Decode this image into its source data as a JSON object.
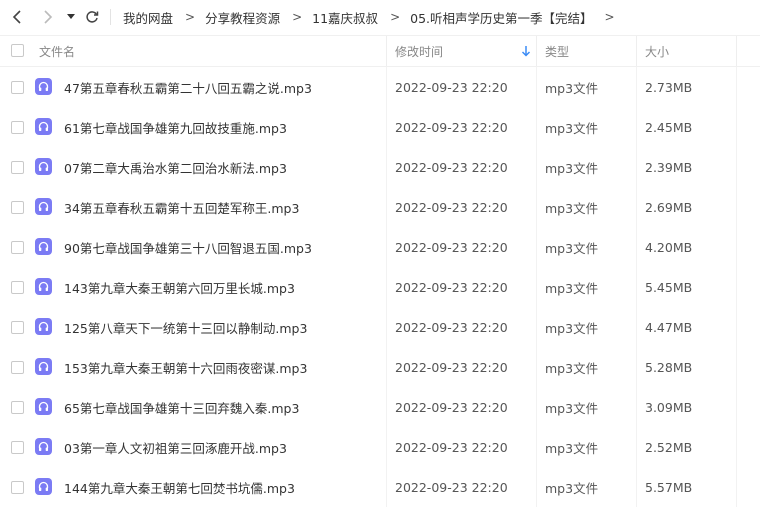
{
  "nav": {
    "back_icon": "chevron-left-icon",
    "forward_icon": "chevron-right-icon",
    "history_icon": "caret-down-icon",
    "refresh_icon": "refresh-icon"
  },
  "breadcrumb": [
    {
      "label": "我的网盘"
    },
    {
      "label": "分享教程资源"
    },
    {
      "label": "11嘉庆叔叔"
    },
    {
      "label": "05.听相声学历史第一季【完结】"
    }
  ],
  "breadcrumb_sep": ">",
  "header": {
    "name": "文件名",
    "time": "修改时间",
    "type": "类型",
    "size": "大小",
    "sort_icon": "arrow-down-icon"
  },
  "colors": {
    "file_icon_bg": "#7b7bf4",
    "sort_arrow": "#3b8cf5"
  },
  "files": [
    {
      "name": "47第五章春秋五霸第二十八回五霸之说.mp3",
      "time": "2022-09-23 22:20",
      "type": "mp3文件",
      "size": "2.73MB"
    },
    {
      "name": "61第七章战国争雄第九回故技重施.mp3",
      "time": "2022-09-23 22:20",
      "type": "mp3文件",
      "size": "2.45MB"
    },
    {
      "name": "07第二章大禹治水第二回治水新法.mp3",
      "time": "2022-09-23 22:20",
      "type": "mp3文件",
      "size": "2.39MB"
    },
    {
      "name": "34第五章春秋五霸第十五回楚军称王.mp3",
      "time": "2022-09-23 22:20",
      "type": "mp3文件",
      "size": "2.69MB"
    },
    {
      "name": "90第七章战国争雄第三十八回智退五国.mp3",
      "time": "2022-09-23 22:20",
      "type": "mp3文件",
      "size": "4.20MB"
    },
    {
      "name": "143第九章大秦王朝第六回万里长城.mp3",
      "time": "2022-09-23 22:20",
      "type": "mp3文件",
      "size": "5.45MB"
    },
    {
      "name": "125第八章天下一统第十三回以静制动.mp3",
      "time": "2022-09-23 22:20",
      "type": "mp3文件",
      "size": "4.47MB"
    },
    {
      "name": "153第九章大秦王朝第十六回雨夜密谋.mp3",
      "time": "2022-09-23 22:20",
      "type": "mp3文件",
      "size": "5.28MB"
    },
    {
      "name": "65第七章战国争雄第十三回弃魏入秦.mp3",
      "time": "2022-09-23 22:20",
      "type": "mp3文件",
      "size": "3.09MB"
    },
    {
      "name": "03第一章人文初祖第三回涿鹿开战.mp3",
      "time": "2022-09-23 22:20",
      "type": "mp3文件",
      "size": "2.52MB"
    },
    {
      "name": "144第九章大秦王朝第七回焚书坑儒.mp3",
      "time": "2022-09-23 22:20",
      "type": "mp3文件",
      "size": "5.57MB"
    }
  ]
}
